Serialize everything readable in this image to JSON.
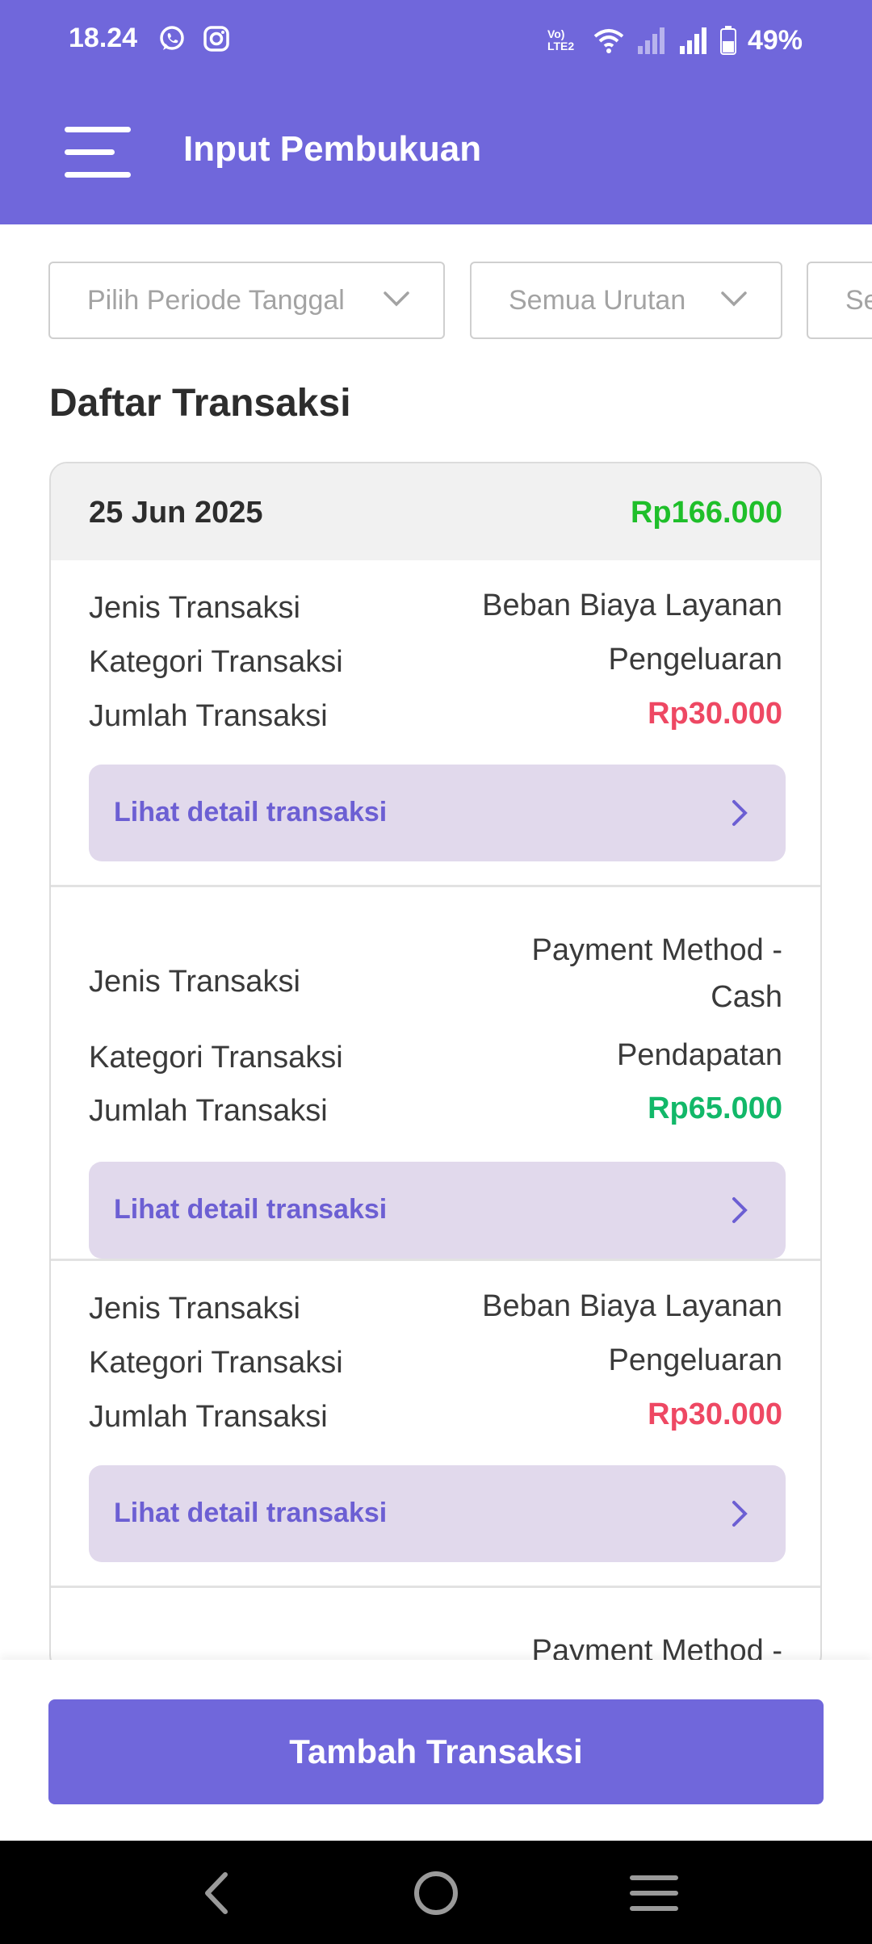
{
  "status_bar": {
    "time": "18.24",
    "signal_label": "Vo) LTE2",
    "battery": "49%"
  },
  "header": {
    "title": "Input Pembukuan"
  },
  "filters": [
    {
      "label": "Pilih Periode Tanggal"
    },
    {
      "label": "Semua Urutan"
    },
    {
      "label": "Se"
    }
  ],
  "section_title": "Daftar Transaksi",
  "group": {
    "date": "25 Jun 2025",
    "total": "Rp166.000"
  },
  "labels": {
    "type": "Jenis Transaksi",
    "category": "Kategori Transaksi",
    "amount": "Jumlah Transaksi",
    "detail": "Lihat detail transaksi"
  },
  "transactions": [
    {
      "type_line1": "Beban Biaya Layanan",
      "type_line2": "",
      "category": "Pengeluaran",
      "amount": "Rp30.000",
      "amount_color": "#ee4863"
    },
    {
      "type_line1": "Payment Method -",
      "type_line2": "Cash",
      "category": "Pendapatan",
      "amount": "Rp65.000",
      "amount_color": "#12b869"
    },
    {
      "type_line1": "Beban Biaya Layanan",
      "type_line2": "",
      "category": "Pengeluaran",
      "amount": "Rp30.000",
      "amount_color": "#ee4863"
    },
    {
      "type_line1": "Payment Method -",
      "type_line2": "",
      "category": "",
      "amount": "",
      "amount_color": ""
    }
  ],
  "bottom": {
    "add_button": "Tambah Transaksi"
  },
  "colors": {
    "primary": "#7067db",
    "income": "#12b869",
    "expense": "#ee4863",
    "group_total": "#1fbf2a",
    "detail_bg": "#e1d9ec"
  },
  "icons": [
    "whatsapp-icon",
    "instagram-icon",
    "wifi-icon",
    "signal-icon",
    "battery-icon",
    "menu-icon",
    "chevron-down-icon",
    "chevron-right-icon",
    "back-icon",
    "home-icon",
    "recents-icon"
  ]
}
